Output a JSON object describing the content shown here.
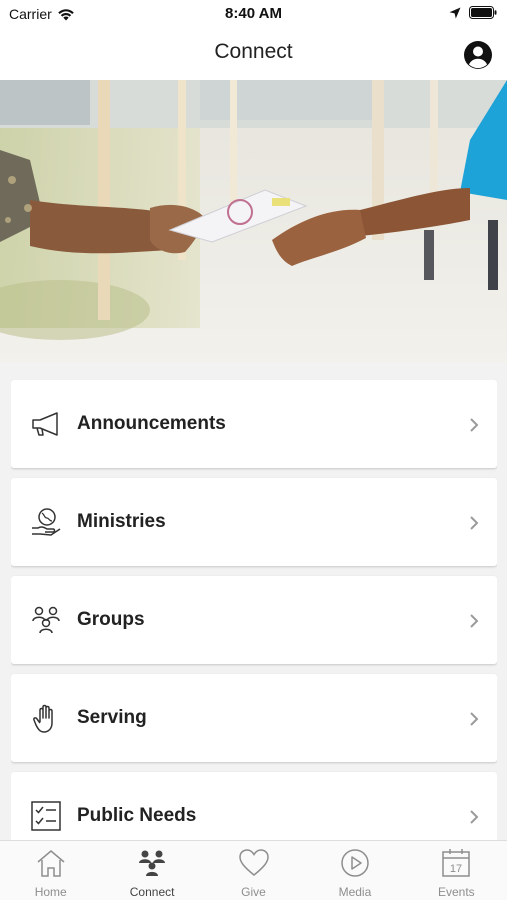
{
  "status_bar": {
    "carrier": "Carrier",
    "time": "8:40 AM"
  },
  "nav": {
    "title": "Connect"
  },
  "menu": {
    "items": [
      {
        "label": "Announcements",
        "icon": "megaphone-icon"
      },
      {
        "label": "Ministries",
        "icon": "globe-hand-icon"
      },
      {
        "label": "Groups",
        "icon": "people-group-icon"
      },
      {
        "label": "Serving",
        "icon": "raised-hand-icon"
      },
      {
        "label": "Public Needs",
        "icon": "checklist-icon"
      }
    ]
  },
  "tabs": [
    {
      "label": "Home",
      "icon": "home-icon",
      "active": false
    },
    {
      "label": "Connect",
      "icon": "connect-icon",
      "active": true
    },
    {
      "label": "Give",
      "icon": "heart-icon",
      "active": false
    },
    {
      "label": "Media",
      "icon": "play-icon",
      "active": false
    },
    {
      "label": "Events",
      "icon": "calendar-icon",
      "active": false,
      "calendar_day": "17"
    }
  ],
  "colors": {
    "accent_blue": "#1ea3d8",
    "background": "#f2f2f2",
    "card": "#ffffff",
    "tab_inactive": "#8e8e8e"
  }
}
